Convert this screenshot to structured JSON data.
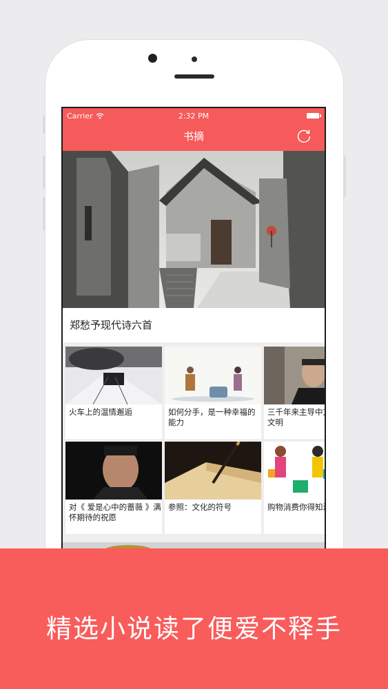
{
  "status_bar": {
    "carrier": "Carrier",
    "time": "2:32 PM"
  },
  "nav": {
    "title": "书摘",
    "refresh_icon": "refresh-icon"
  },
  "featured": {
    "title": "郑愁予现代诗六首"
  },
  "articles": [
    {
      "title": "火车上的温情邂逅"
    },
    {
      "title": "如何分手，是一种幸福的能力"
    },
    {
      "title": "三千年来主导中方法论的文明"
    },
    {
      "title": "对《 爱是心中的蔷薇 》满怀期待的祝愿"
    },
    {
      "title": "参照：文化的符号"
    },
    {
      "title": "购物消费你得知济学常识"
    }
  ],
  "banner": {
    "text": "精选小说读了便爱不释手"
  },
  "colors": {
    "accent": "#f65a5a",
    "banner": "#f85c5b"
  }
}
